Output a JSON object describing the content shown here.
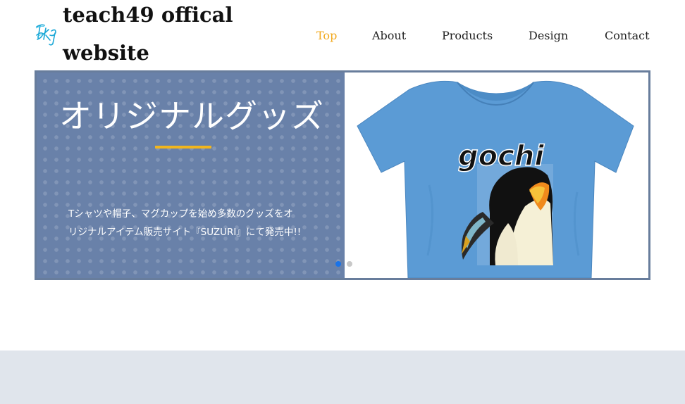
{
  "site": {
    "title": "teach49 offical website",
    "logo_text": "Tk49"
  },
  "nav": {
    "items": [
      {
        "label": "Top",
        "active": true
      },
      {
        "label": "About",
        "active": false
      },
      {
        "label": "Products",
        "active": false
      },
      {
        "label": "Design",
        "active": false
      },
      {
        "label": "Contact",
        "active": false
      }
    ]
  },
  "slider": {
    "heading": "オリジナルグッズ",
    "description_line1": "Tシャツや帽子、マグカップを始め多数のグッズをオ",
    "description_line2": "リジナルアイテム販売サイト『SUZURI』にて発売中!!",
    "tshirt_print": "gochi",
    "slide_count": 2,
    "active_slide": 1
  },
  "colors": {
    "accent": "#f2a91e",
    "slider_bg": "#6981a9",
    "slider_border": "#687d9c",
    "underline": "#f2b61d",
    "tshirt": "#5b9bd5",
    "dot_active": "#1a73e8",
    "dot_inactive": "#c8c8c8",
    "footer": "#e0e5ec"
  }
}
